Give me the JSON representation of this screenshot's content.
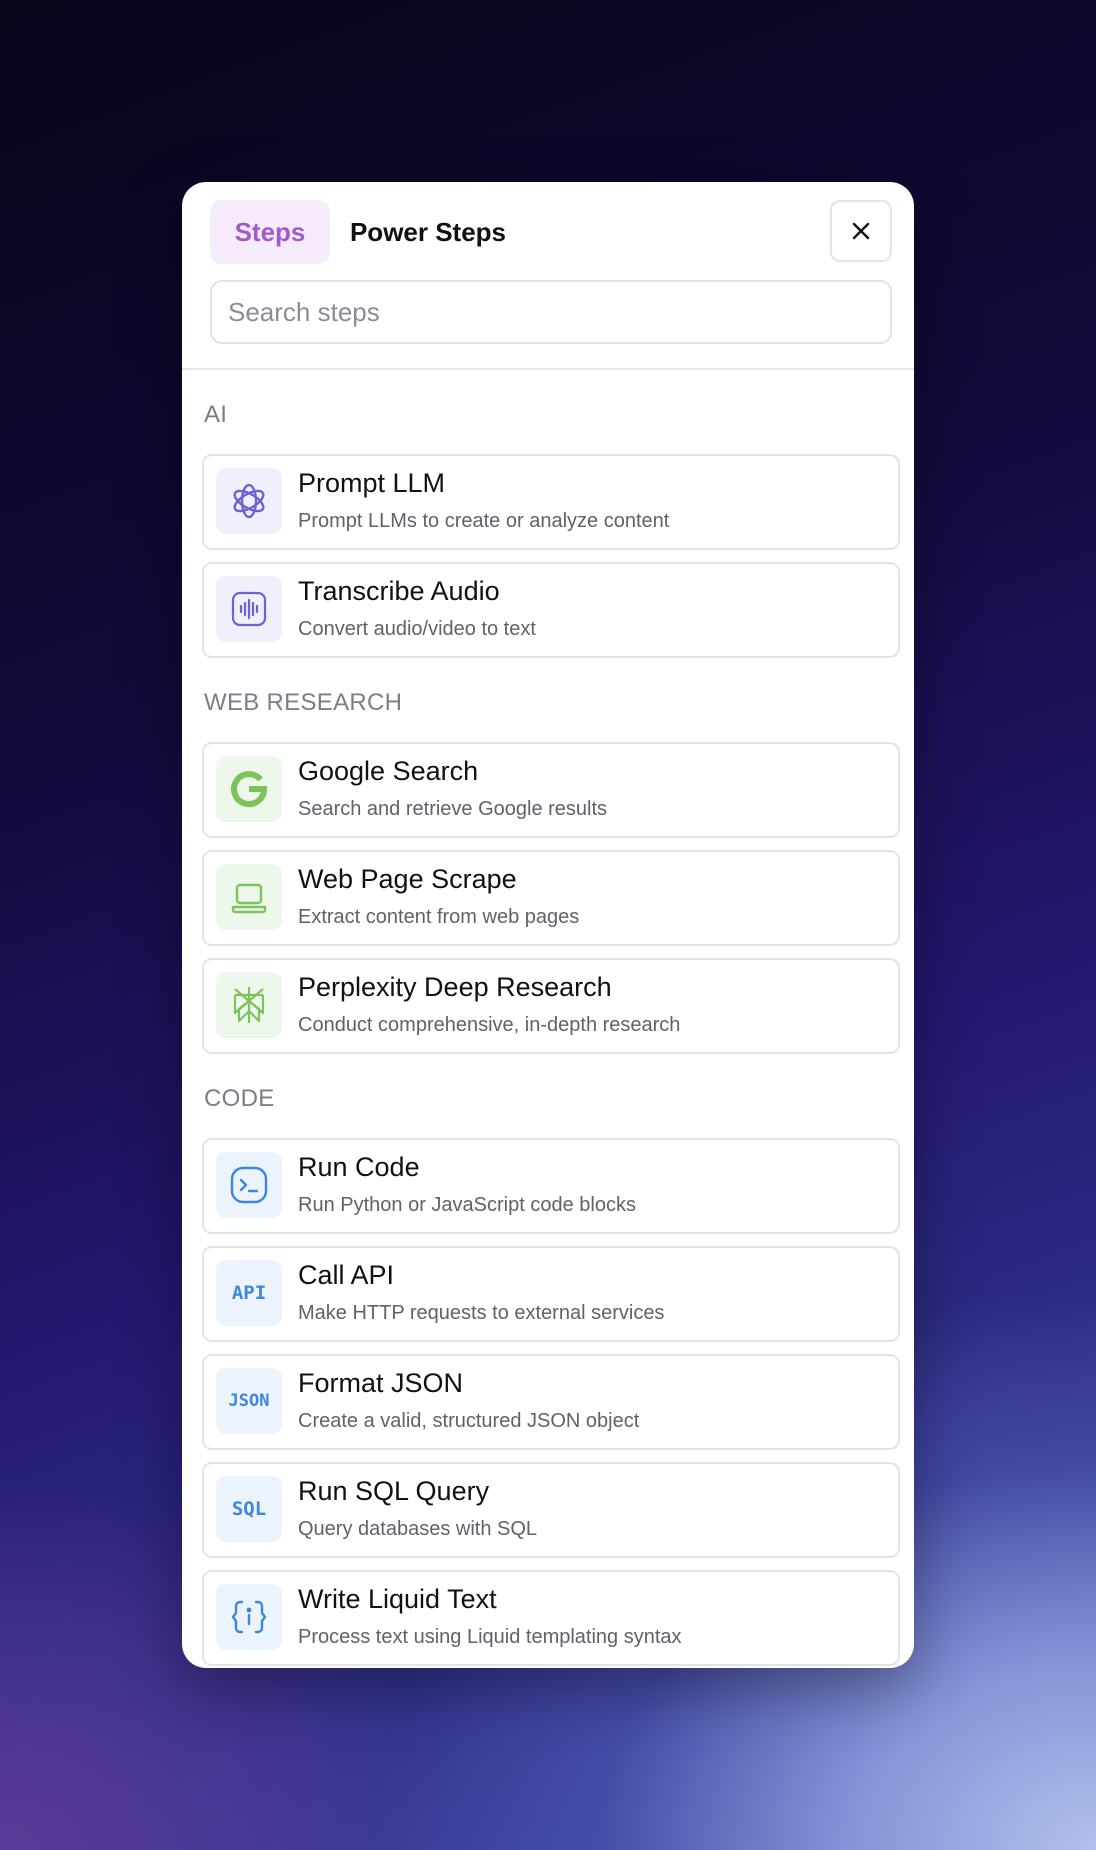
{
  "tabs": {
    "steps": "Steps",
    "power_steps": "Power Steps"
  },
  "search": {
    "placeholder": "Search steps",
    "value": ""
  },
  "colors": {
    "accent": "#a259cf",
    "ai_icon": "#6a63d8",
    "web_icon": "#7cc45a",
    "code_icon": "#3f86e0"
  },
  "sections": [
    {
      "title": "AI",
      "items": [
        {
          "title": "Prompt LLM",
          "description": "Prompt LLMs to create or analyze content",
          "icon": "openai-icon"
        },
        {
          "title": "Transcribe Audio",
          "description": "Convert audio/video to text",
          "icon": "audio-wave-icon"
        }
      ]
    },
    {
      "title": "WEB RESEARCH",
      "items": [
        {
          "title": "Google Search",
          "description": "Search and retrieve Google results",
          "icon": "google-icon"
        },
        {
          "title": "Web Page Scrape",
          "description": "Extract content from web pages",
          "icon": "laptop-icon"
        },
        {
          "title": "Perplexity Deep Research",
          "description": "Conduct comprehensive, in-depth research",
          "icon": "perplexity-icon"
        }
      ]
    },
    {
      "title": "CODE",
      "items": [
        {
          "title": "Run Code",
          "description": "Run Python or JavaScript code blocks",
          "icon": "terminal-icon"
        },
        {
          "title": "Call API",
          "description": "Make HTTP requests to external services",
          "icon": "api-icon",
          "icon_text": "API"
        },
        {
          "title": "Format JSON",
          "description": "Create a valid, structured JSON object",
          "icon": "json-icon",
          "icon_text": "JSON"
        },
        {
          "title": "Run SQL Query",
          "description": "Query databases with SQL",
          "icon": "sql-icon",
          "icon_text": "SQL"
        },
        {
          "title": "Write Liquid Text",
          "description": "Process text using Liquid templating syntax",
          "icon": "braces-icon"
        }
      ]
    }
  ]
}
